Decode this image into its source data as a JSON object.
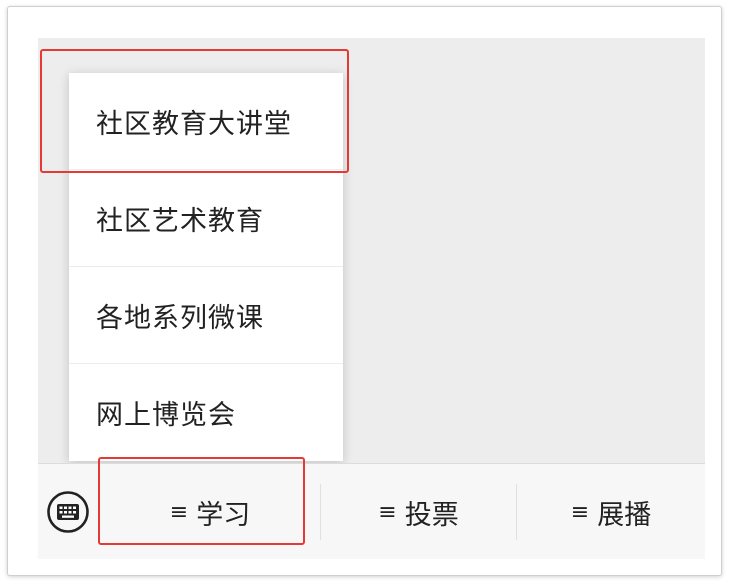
{
  "menu": {
    "items": [
      {
        "label": "社区教育大讲堂"
      },
      {
        "label": "社区艺术教育"
      },
      {
        "label": "各地系列微课"
      },
      {
        "label": "网上博览会"
      }
    ]
  },
  "bottom_bar": {
    "keyboard_icon": "keyboard-icon",
    "tabs": [
      {
        "glyph": "≡",
        "label": "学习"
      },
      {
        "glyph": "≡",
        "label": "投票"
      },
      {
        "glyph": "≡",
        "label": "展播"
      }
    ]
  },
  "colors": {
    "highlight": "#e53935",
    "background": "#ededed"
  }
}
